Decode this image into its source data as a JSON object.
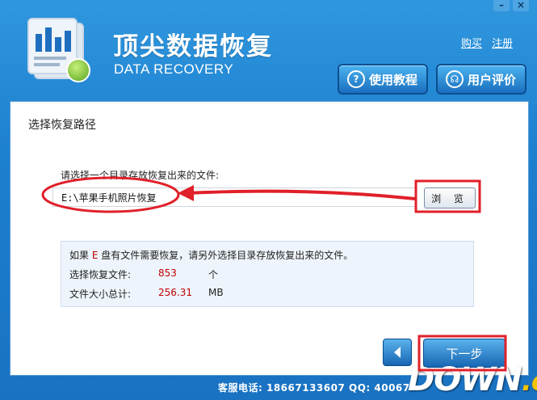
{
  "header": {
    "title_cn": "顶尖数据恢复",
    "title_en": "DATA RECOVERY",
    "links": [
      "购买",
      "注册"
    ],
    "buttons": [
      {
        "label": "使用教程",
        "icon": "help-icon"
      },
      {
        "label": "用户评价",
        "icon": "headset-icon"
      }
    ],
    "window_controls": [
      "–",
      "×"
    ]
  },
  "content": {
    "section_title": "选择恢复路径",
    "prompt": "请选择一个目录存放恢复出来的文件:",
    "path_value": "E:\\苹果手机照片恢复",
    "browse_label": "浏 览",
    "info": {
      "line1_prefix": "如果 ",
      "line1_drive": "E",
      "line1_suffix": " 盘有文件需要恢复，请另外选择目录存放恢复出来的文件。",
      "files_label": "选择恢复文件:",
      "files_count": "853",
      "files_unit": "个",
      "size_label": "文件大小总计:",
      "size_value": "256.31",
      "size_unit": "MB"
    }
  },
  "nav": {
    "prev_icon": "chevron-left-icon",
    "next_label": "下一步"
  },
  "footer": {
    "text": "客服电话: 18667133607 QQ: 40067"
  },
  "watermark": {
    "main": "DOWN",
    "suffix": ".cc"
  },
  "colors": {
    "annotation_red": "#e0202a",
    "highlight_red": "#c00000",
    "brand_blue": "#1d7fcf"
  }
}
